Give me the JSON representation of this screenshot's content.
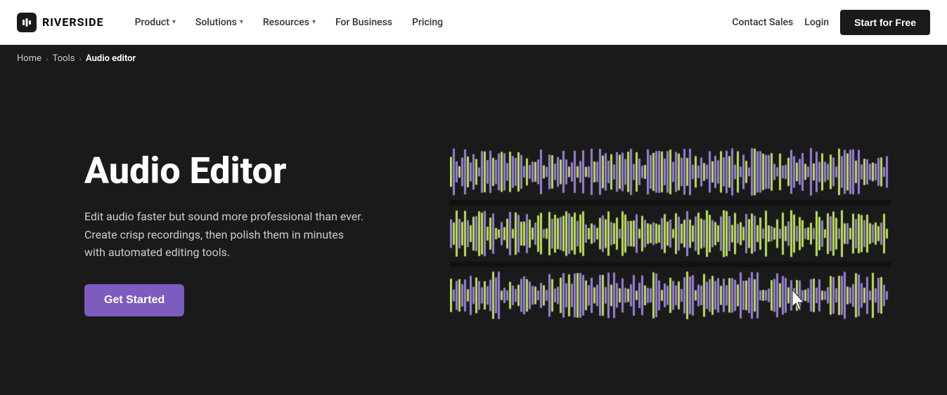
{
  "logo": {
    "text": "RIVERSIDE"
  },
  "nav": {
    "items": [
      {
        "label": "Product",
        "has_dropdown": true
      },
      {
        "label": "Solutions",
        "has_dropdown": true
      },
      {
        "label": "Resources",
        "has_dropdown": true
      },
      {
        "label": "For Business",
        "has_dropdown": false
      },
      {
        "label": "Pricing",
        "has_dropdown": false
      }
    ],
    "right": {
      "contact_sales": "Contact Sales",
      "login": "Login",
      "cta": "Start for Free"
    }
  },
  "breadcrumb": {
    "home": "Home",
    "tools": "Tools",
    "current": "Audio editor"
  },
  "hero": {
    "title": "Audio Editor",
    "description": "Edit audio faster but sound more professional than ever. Create crisp recordings, then polish them in minutes with automated editing tools.",
    "cta_label": "Get Started"
  },
  "colors": {
    "purple": "#9b7fd4",
    "green": "#b8e05a",
    "bg": "#1a1a1a",
    "separator": "#111"
  }
}
